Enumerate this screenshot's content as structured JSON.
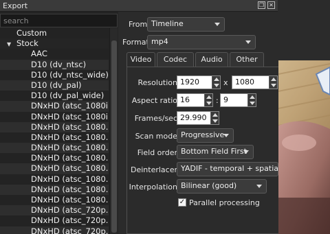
{
  "window": {
    "title": "Export"
  },
  "search": {
    "placeholder": "search"
  },
  "tree": {
    "categories": [
      {
        "label": "Custom",
        "expanded": false
      },
      {
        "label": "Stock",
        "expanded": true
      }
    ],
    "presets": [
      "AAC",
      "D10 (dv_ntsc)",
      "D10 (dv_ntsc_wide)",
      "D10 (dv_pal)",
      "D10 (dv_pal_wide)",
      "DNxHD (atsc_1080i...",
      "DNxHD (atsc_1080i...",
      "DNxHD (atsc_1080...",
      "DNxHD (atsc_1080...",
      "DNxHD (atsc_1080...",
      "DNxHD (atsc_1080...",
      "DNxHD (atsc_1080...",
      "DNxHD (atsc_1080...",
      "DNxHD (atsc_1080...",
      "DNxHD (atsc_1080...",
      "DNxHD (atsc_720p...",
      "DNxHD (atsc_720p...",
      "DNxHD (atsc_720p..."
    ]
  },
  "from": {
    "label": "From",
    "value": "Timeline"
  },
  "format": {
    "label": "Format",
    "value": "mp4"
  },
  "tabs": [
    "Video",
    "Codec",
    "Audio",
    "Other"
  ],
  "video": {
    "resolution": {
      "label": "Resolution",
      "width": "1920",
      "sep": "x",
      "height": "1080"
    },
    "aspect": {
      "label": "Aspect ratio",
      "num": "16",
      "sep": ":",
      "den": "9"
    },
    "fps": {
      "label": "Frames/sec",
      "value": "29.990"
    },
    "scan": {
      "label": "Scan mode",
      "value": "Progressive"
    },
    "field": {
      "label": "Field order",
      "value": "Bottom Field First"
    },
    "deinterlacer": {
      "label": "Deinterlacer",
      "value": "YADIF - temporal + spatial"
    },
    "interpolation": {
      "label": "Interpolation",
      "value": "Bilinear (good)"
    },
    "parallel": {
      "label": "Parallel processing",
      "checked": true,
      "mark": "✓"
    }
  },
  "colors": {
    "background": "#2b2b2b",
    "panel": "#232323",
    "field": "#ffffff"
  }
}
